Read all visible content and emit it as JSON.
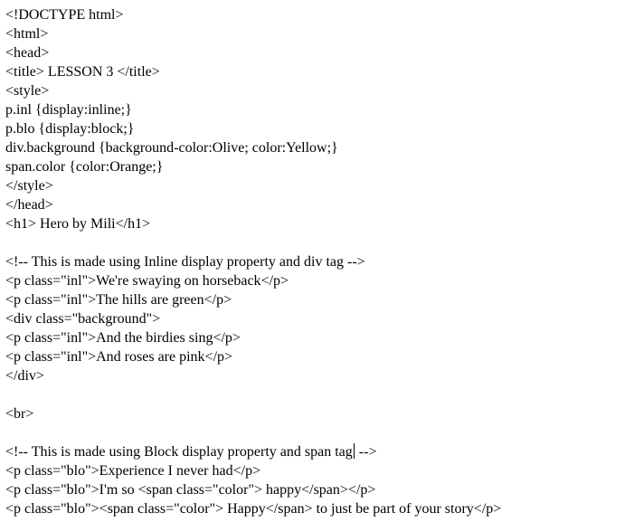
{
  "editor": {
    "lines": [
      "<!DOCTYPE html>",
      "<html>",
      "<head>",
      "<title> LESSON 3 </title>",
      "<style>",
      "p.inl {display:inline;}",
      "p.blo {display:block;}",
      "div.background {background-color:Olive; color:Yellow;}",
      "span.color {color:Orange;}",
      "</style>",
      "</head>",
      "<h1> Hero by Mili</h1>",
      "",
      "<!-- This is made using Inline display property and div tag -->",
      "<p class=\"inl\">We're swaying on horseback</p>",
      "<p class=\"inl\">The hills are green</p>",
      "<div class=\"background\">",
      "<p class=\"inl\">And the birdies sing</p>",
      "<p class=\"inl\">And roses are pink</p>",
      "</div>",
      "",
      "<br>",
      "",
      "<!-- This is made using Block display property and span tag",
      "<p class=\"blo\">Experience I never had</p>",
      "<p class=\"blo\">I'm so <span class=\"color\"> happy</span></p>",
      "<p class=\"blo\"><span class=\"color\"> Happy</span> to just be part of your story</p>"
    ],
    "line_24_tail": " -->"
  }
}
